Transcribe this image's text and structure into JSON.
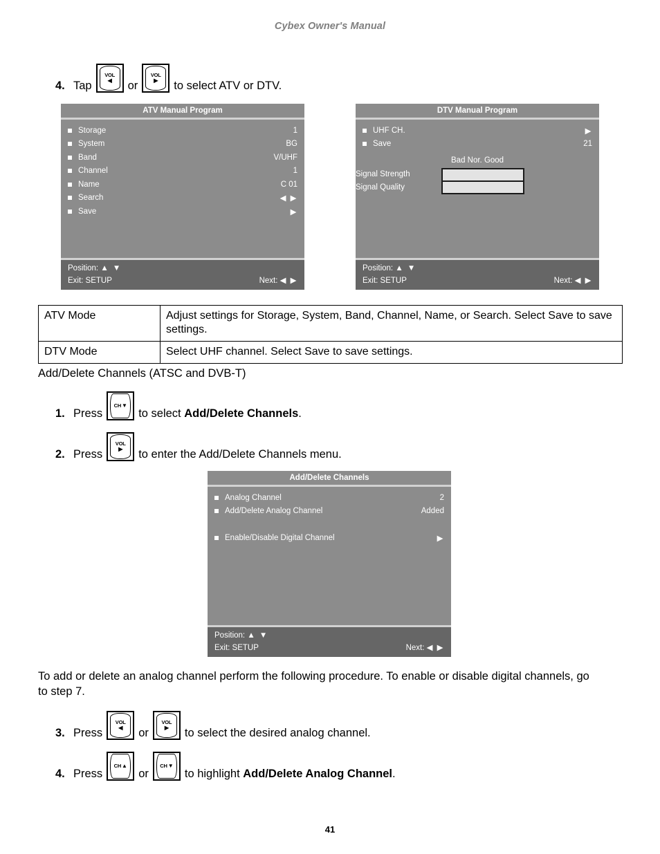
{
  "header": {
    "running_head": "Cybex Owner's Manual"
  },
  "page": {
    "number": "41"
  },
  "steps": {
    "s4a": {
      "num": "4.",
      "pre": "Tap",
      "mid": "or",
      "post": "to select ATV or DTV."
    },
    "s1": {
      "num": "1.",
      "pre": "Press",
      "post_plain": "to select ",
      "post_bold": "Add/Delete Channels",
      "post_tail": "."
    },
    "s2": {
      "num": "2.",
      "pre": "Press",
      "post": "to enter the Add/Delete Channels menu."
    },
    "s3": {
      "num": "3.",
      "pre": "Press",
      "mid": "or",
      "post": "to select the desired analog channel."
    },
    "s4b": {
      "num": "4.",
      "pre": "Press",
      "mid": "or",
      "post_plain": "to highlight ",
      "post_bold": "Add/Delete Analog Channel",
      "post_tail": "."
    }
  },
  "keys": {
    "vol_left": {
      "label": "VOL",
      "arrow": "◀"
    },
    "vol_right": {
      "label": "VOL",
      "arrow": "▶"
    },
    "ch_up": {
      "label": "CH",
      "arrow": "▲"
    },
    "ch_down": {
      "label": "CH",
      "arrow": "▼"
    }
  },
  "osd_atv": {
    "title": "ATV Manual Program",
    "rows": [
      {
        "label": "Storage",
        "value": "1"
      },
      {
        "label": "System",
        "value": "BG"
      },
      {
        "label": "Band",
        "value": "V/UHF"
      },
      {
        "label": "Channel",
        "value": "1"
      },
      {
        "label": "Name",
        "value": "C 01"
      },
      {
        "label": "Search",
        "value": "◀ ▶"
      },
      {
        "label": "Save",
        "value": "▶"
      }
    ],
    "footer": {
      "position_label": "Position:",
      "position_arrows": "▲ ▼",
      "exit": "Exit: SETUP",
      "next_label": "Next:",
      "next_arrows": "◀ ▶"
    }
  },
  "osd_dtv": {
    "title": "DTV Manual Program",
    "rows": [
      {
        "label": "UHF CH.",
        "value": "▶"
      },
      {
        "label": "Save",
        "value": "21"
      }
    ],
    "signal": {
      "scale": "Bad  Nor.  Good",
      "strength_label": "Signal Strength",
      "quality_label": "Signal Quality"
    },
    "footer": {
      "position_label": "Position:",
      "position_arrows": "▲ ▼",
      "exit": "Exit: SETUP",
      "next_label": "Next:",
      "next_arrows": "◀ ▶"
    }
  },
  "osd_addel": {
    "title": "Add/Delete Channels",
    "rows": [
      {
        "label": "Analog Channel",
        "value": "2"
      },
      {
        "label": "Add/Delete Analog Channel",
        "value": "Added"
      },
      {
        "label": "Enable/Disable Digital Channel",
        "value": "▶"
      }
    ],
    "footer": {
      "position_label": "Position:",
      "position_arrows": "▲ ▼",
      "exit": "Exit: SETUP",
      "next_label": "Next:",
      "next_arrows": "◀ ▶"
    }
  },
  "mode_table": {
    "rows": [
      {
        "mode": "ATV Mode",
        "desc": "Adjust settings for Storage, System, Band, Channel, Name, or Search. Select Save to save settings."
      },
      {
        "mode": "DTV Mode",
        "desc": "Select UHF channel. Select Save to save settings."
      }
    ]
  },
  "paragraphs": {
    "section_heading": "Add/Delete Channels (ATSC and DVB-T)",
    "body": "To add or delete an analog channel perform the following procedure. To enable or disable digital channels, go to step 7."
  }
}
